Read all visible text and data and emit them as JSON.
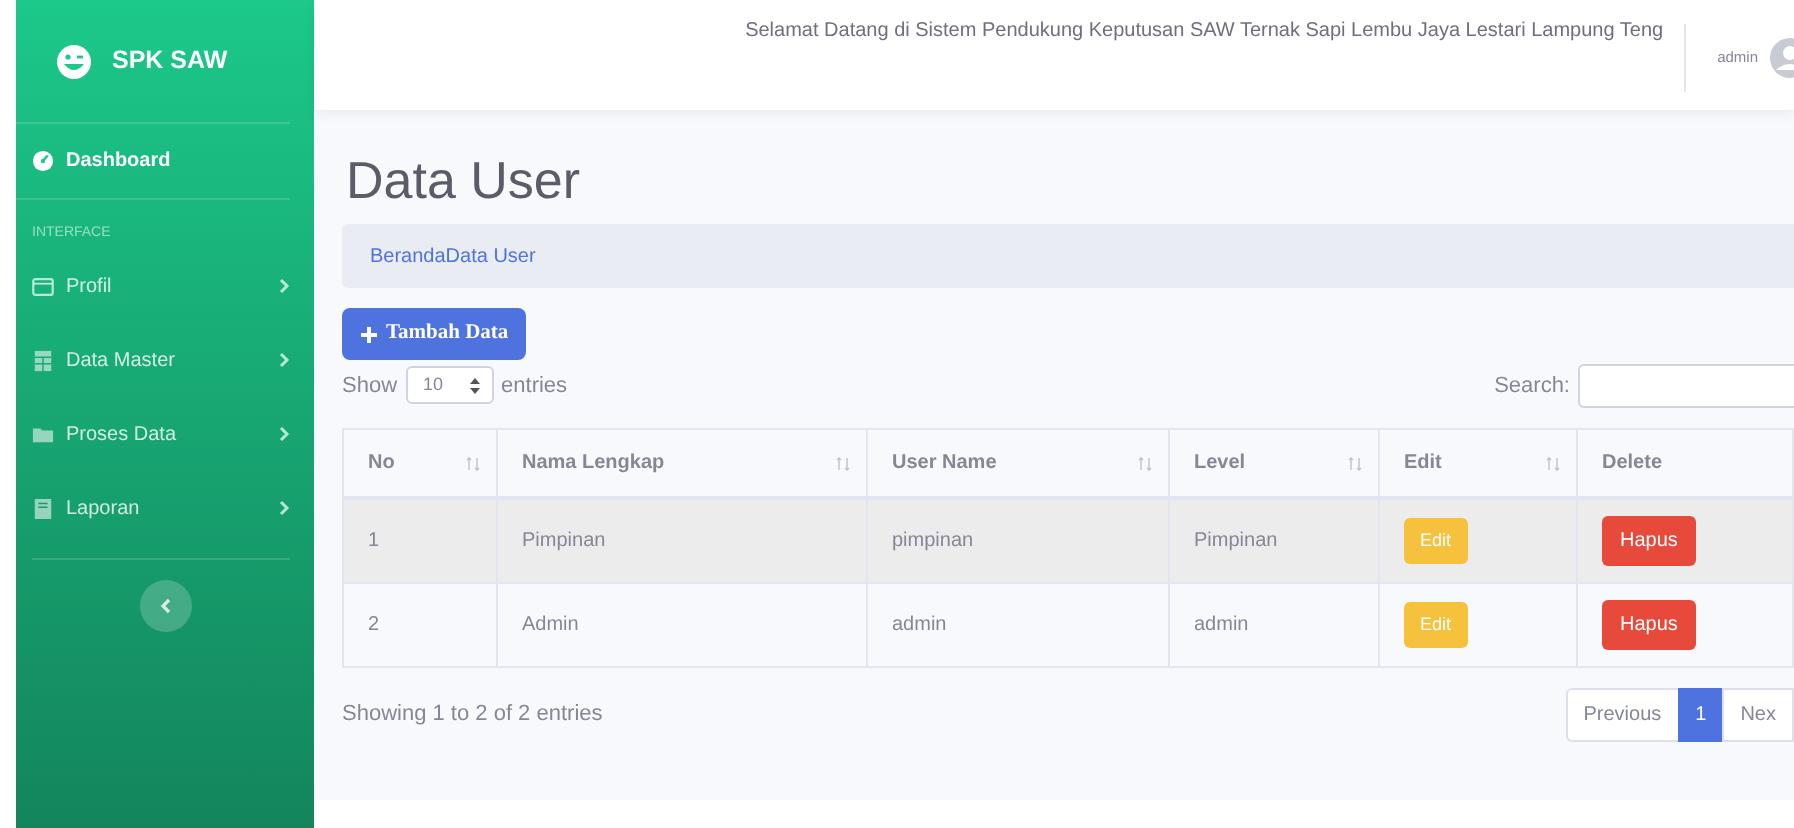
{
  "brand": {
    "name": "SPK SAW"
  },
  "sidebar": {
    "items": [
      {
        "kind": "link",
        "label": "Dashboard",
        "selected": true,
        "arrow": false
      },
      {
        "kind": "heading",
        "label": "INTERFACE"
      },
      {
        "kind": "link",
        "label": "Profil",
        "selected": false,
        "arrow": true
      },
      {
        "kind": "link",
        "label": "Data Master",
        "selected": false,
        "arrow": true
      },
      {
        "kind": "link",
        "label": "Proses Data",
        "selected": false,
        "arrow": true
      },
      {
        "kind": "link",
        "label": "Laporan",
        "selected": false,
        "arrow": true
      }
    ]
  },
  "topbar": {
    "welcome": "Selamat Datang di Sistem Pendukung Keputusan SAW Ternak Sapi Lembu Jaya Lestari Lampung Teng",
    "user": "admin"
  },
  "page_title": "Data User",
  "breadcrumb": "BerandaData User",
  "add_button": "Tambah Data",
  "length": {
    "prefix": "Show",
    "value": "10",
    "suffix": "entries"
  },
  "search": {
    "label": "Search:"
  },
  "table": {
    "columns": [
      "No",
      "Nama Lengkap",
      "User Name",
      "Level",
      "Edit",
      "Delete"
    ],
    "rows": [
      {
        "cells": [
          "1",
          "Pimpinan",
          "pimpinan",
          "Pimpinan"
        ],
        "edit": "Edit",
        "delete": "Hapus",
        "highlighted": true
      },
      {
        "cells": [
          "2",
          "Admin",
          "admin",
          "admin"
        ],
        "edit": "Edit",
        "delete": "Hapus",
        "highlighted": false
      }
    ]
  },
  "info": "Showing 1 to 2 of 2 entries",
  "pagination": [
    {
      "label": "Previous",
      "selected": false
    },
    {
      "label": "1",
      "selected": true
    },
    {
      "label": "Nex",
      "selected": false
    }
  ]
}
